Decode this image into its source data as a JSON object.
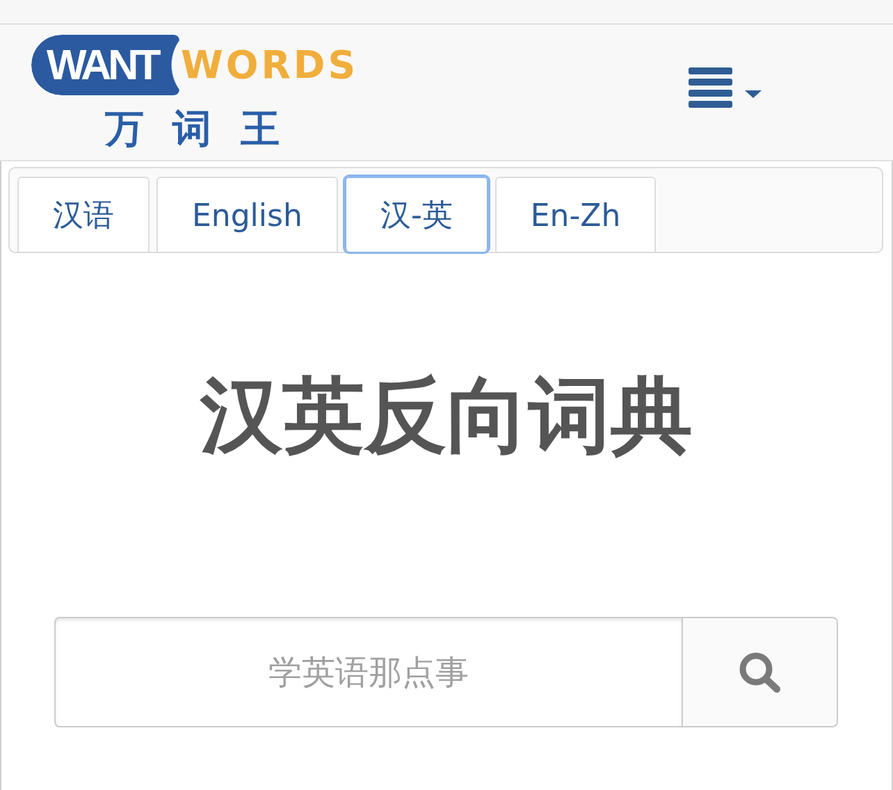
{
  "logo": {
    "badge_text": "WANT",
    "wordmark": "WORDS",
    "chinese_name": "万 词 王"
  },
  "tabs": [
    {
      "label": "汉语",
      "selected": false
    },
    {
      "label": "English",
      "selected": false
    },
    {
      "label": "汉-英",
      "selected": true
    },
    {
      "label": "En-Zh",
      "selected": false
    }
  ],
  "title": "汉英反向词典",
  "search": {
    "placeholder": "学英语那点事"
  }
}
